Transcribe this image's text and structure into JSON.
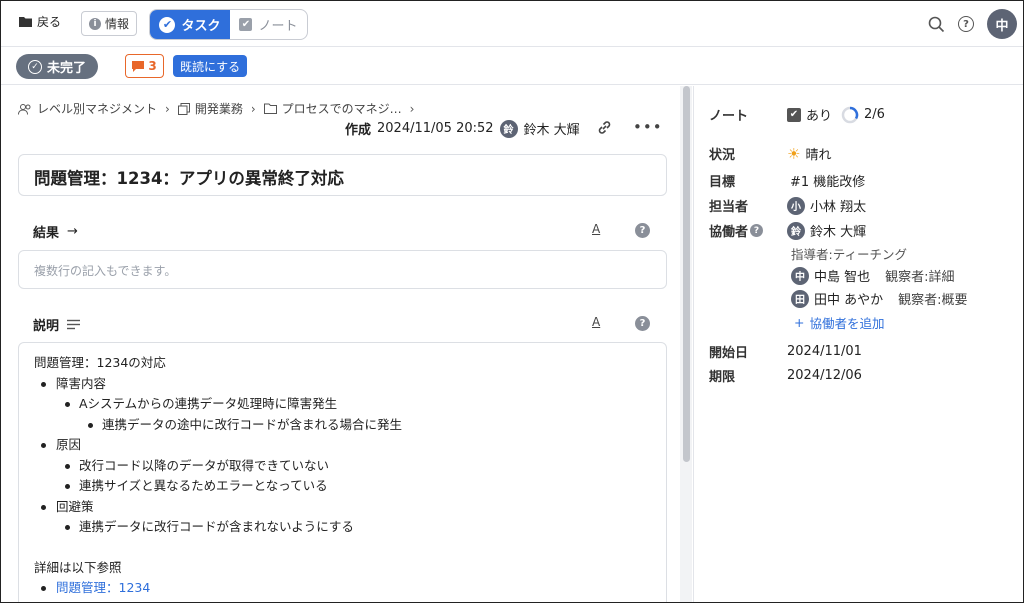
{
  "topbar": {
    "back_label": "戻る",
    "info_label": "情報",
    "tabs": [
      {
        "label": "タスク",
        "active": true
      },
      {
        "label": "ノート",
        "active": false
      }
    ],
    "user_initial": "中"
  },
  "statusbar": {
    "status_label": "未完了",
    "comment_count": "3",
    "mark_read_label": "既読にする"
  },
  "breadcrumb": [
    "レベル別マネジメント",
    "開発業務",
    "プロセスでのマネジ…"
  ],
  "meta": {
    "created_label": "作成",
    "created_at": "2024/11/05 20:52",
    "author_initial": "鈴",
    "author_name": "鈴木 大輝"
  },
  "task": {
    "title": "問題管理：1234：アプリの異常終了対応",
    "result_label": "結果",
    "result_placeholder": "複数行の記入もできます。",
    "description_label": "説明",
    "description": {
      "intro": "問題管理：1234の対応",
      "items": [
        {
          "text": "障害内容",
          "children": [
            {
              "text": "Aシステムからの連携データ処理時に障害発生",
              "children": [
                {
                  "text": "連携データの途中に改行コードが含まれる場合に発生"
                }
              ]
            }
          ]
        },
        {
          "text": "原因",
          "children": [
            {
              "text": "改行コード以降のデータが取得できていない"
            },
            {
              "text": "連携サイズと異なるためエラーとなっている"
            }
          ]
        },
        {
          "text": "回避策",
          "children": [
            {
              "text": "連携データに改行コードが含まれないようにする"
            }
          ]
        }
      ],
      "footer": "詳細は以下参照",
      "link": "問題管理：1234"
    }
  },
  "details": {
    "note_label": "ノート",
    "note_value": "あり",
    "note_progress": "2/6",
    "status_label": "状況",
    "status_value": "晴れ",
    "goal_label": "目標",
    "goal_value": "#1 機能改修",
    "assignee_label": "担当者",
    "assignee_initial": "小",
    "assignee_name": "小林 翔太",
    "collab_label": "協働者",
    "collaborators": [
      {
        "initial": "鈴",
        "name": "鈴木 大輝",
        "role": ""
      },
      {
        "initial": "中",
        "name": "中島 智也",
        "role": "観察者:詳細"
      },
      {
        "initial": "田",
        "name": "田中 あやか",
        "role": "観察者:概要"
      }
    ],
    "mentor_line": "指導者:ティーチング",
    "add_collab_label": "協働者を追加",
    "start_label": "開始日",
    "start_value": "2024/11/01",
    "due_label": "期限",
    "due_value": "2024/12/06"
  },
  "colors": {
    "accent": "#2f6fdb",
    "status_pill": "#66707f",
    "comment_badge": "#e8672a"
  }
}
